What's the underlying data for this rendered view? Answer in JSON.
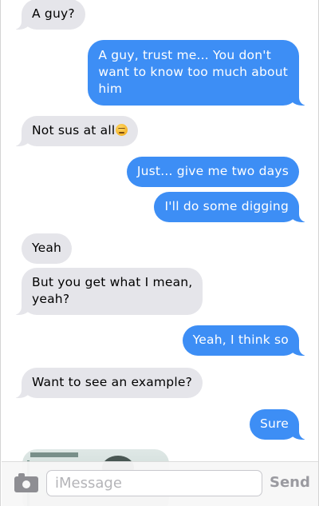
{
  "messages": [
    {
      "side": "received",
      "text": "A guy?"
    },
    {
      "side": "sent",
      "line1": "A guy, trust me... You don't",
      "line2": "want to know too much about",
      "line3": "him"
    },
    {
      "side": "received",
      "text": "Not sus at all",
      "emoji": "expressionless-face-emoji"
    },
    {
      "side": "sent",
      "text": "Just... give me two days"
    },
    {
      "side": "sent",
      "text": "I'll do some digging"
    },
    {
      "side": "received",
      "text": "Yeah"
    },
    {
      "side": "received",
      "line1": "But you get what I mean,",
      "line2": "yeah?"
    },
    {
      "side": "sent",
      "text": "Yeah, I think so"
    },
    {
      "side": "received",
      "text": "Want to see an example?"
    },
    {
      "side": "sent",
      "text": "Sure"
    },
    {
      "side": "received",
      "attachment": "photo"
    }
  ],
  "composer": {
    "placeholder": "iMessage",
    "send_label": "Send",
    "camera_icon": "camera-icon"
  },
  "colors": {
    "sent_bubble": "#3d8ef5",
    "received_bubble": "#e5e5ea",
    "composer_bg": "#f7f7f7"
  }
}
